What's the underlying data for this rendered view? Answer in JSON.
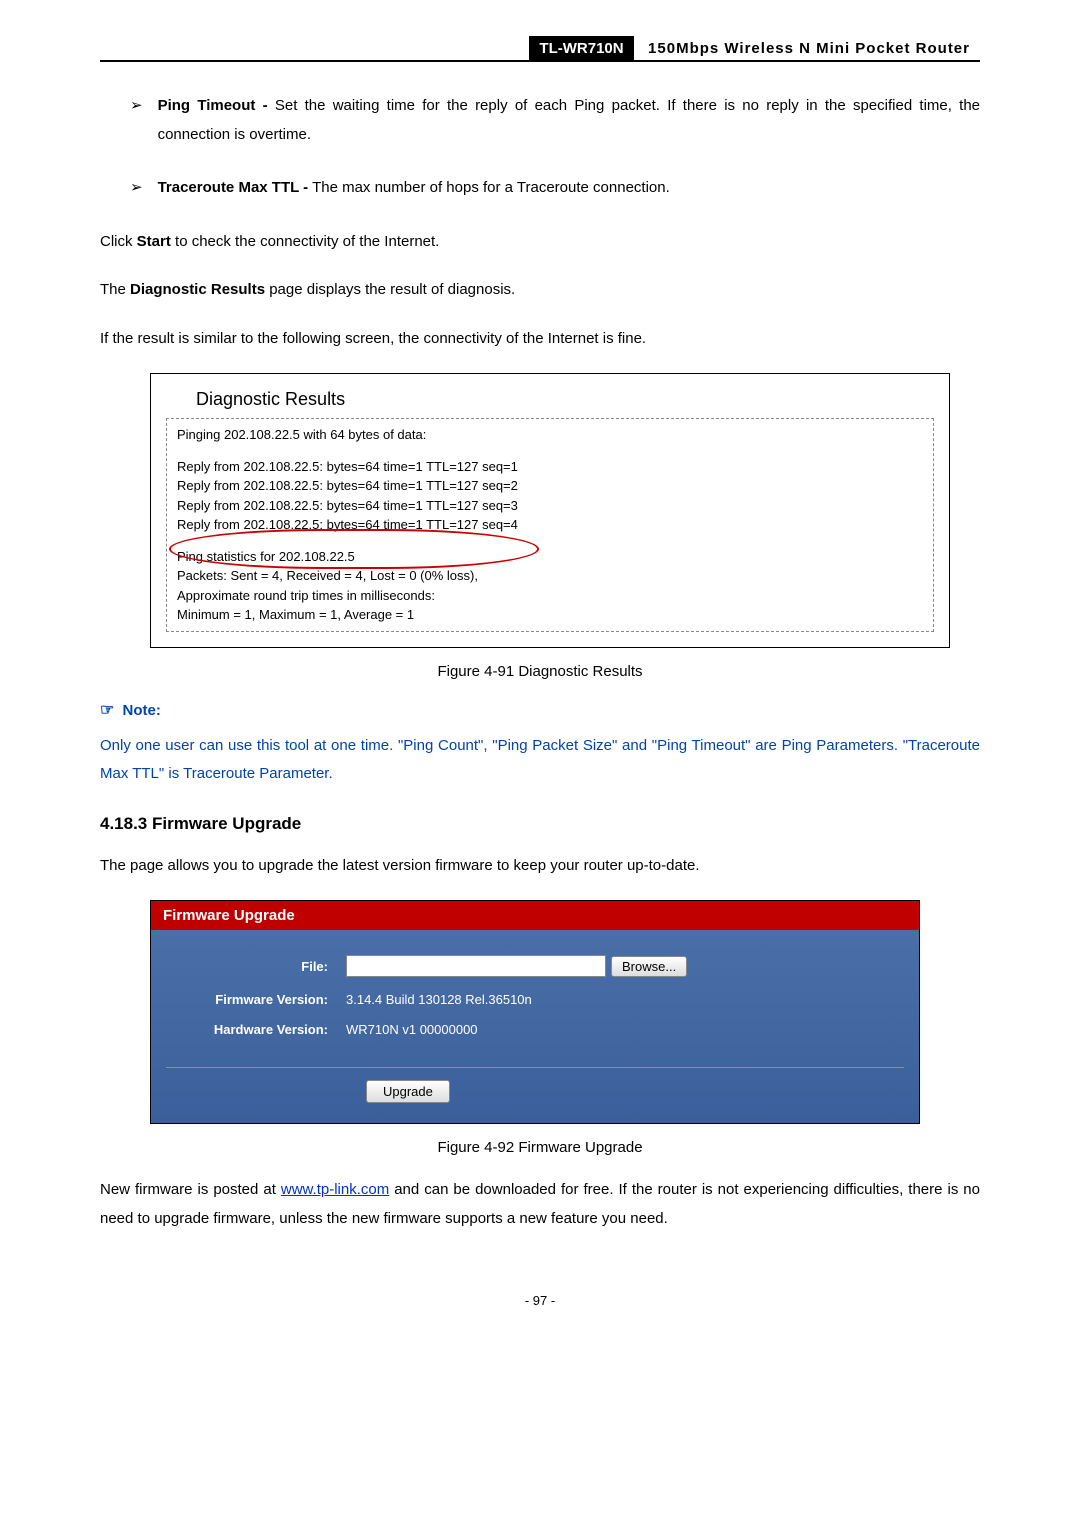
{
  "header": {
    "model": "TL-WR710N",
    "title": "150Mbps Wireless N Mini Pocket Router"
  },
  "bullets": {
    "pingTimeout": {
      "label": "Ping Timeout -",
      "text": " Set the waiting time for the reply of each Ping packet. If there is no reply in the specified time, the connection is overtime."
    },
    "tracerouteTTL": {
      "label": "Traceroute Max TTL -",
      "text": " The max number of hops for a Traceroute connection."
    }
  },
  "paras": {
    "clickStart": "Click ",
    "clickStartBold": "Start",
    "clickStartAfter": " to check the connectivity of the Internet.",
    "diagResults1": "The ",
    "diagResultsBold": "Diagnostic Results",
    "diagResults2": " page displays the result of diagnosis.",
    "ifResult": "If the result is similar to the following screen, the connectivity of the Internet is fine."
  },
  "diagnostic": {
    "title": "Diagnostic Results",
    "lines": {
      "l0": "Pinging 202.108.22.5 with 64 bytes of data:",
      "l1": "Reply from 202.108.22.5:  bytes=64  time=1  TTL=127  seq=1",
      "l2": "Reply from 202.108.22.5:  bytes=64  time=1  TTL=127  seq=2",
      "l3": "Reply from 202.108.22.5:  bytes=64  time=1  TTL=127  seq=3",
      "l4": "Reply from 202.108.22.5:  bytes=64  time=1  TTL=127  seq=4",
      "l5": "Ping statistics for 202.108.22.5",
      "l6": "  Packets: Sent = 4, Received = 4, Lost = 0 (0% loss),",
      "l7": "Approximate round trip times in milliseconds:",
      "l8": "  Minimum = 1, Maximum = 1, Average = 1"
    }
  },
  "fig91": "Figure 4-91    Diagnostic Results",
  "note": {
    "label": "Note:",
    "text": "Only one user can use this tool at one time. \"Ping Count\", \"Ping Packet Size\" and \"Ping Timeout\" are Ping Parameters. \"Traceroute Max TTL\" is Traceroute Parameter."
  },
  "section": {
    "heading": "4.18.3 Firmware Upgrade",
    "intro": "The page allows you to upgrade the latest version firmware to keep your router up-to-date."
  },
  "firmware": {
    "header": "Firmware Upgrade",
    "fileLabel": "File:",
    "fileValue": "",
    "browseLabel": "Browse...",
    "fwVersionLabel": "Firmware Version:",
    "fwVersionValue": "3.14.4 Build 130128 Rel.36510n",
    "hwVersionLabel": "Hardware Version:",
    "hwVersionValue": "WR710N v1 00000000",
    "upgradeLabel": "Upgrade"
  },
  "fig92": "Figure 4-92 Firmware Upgrade",
  "newFirmware": {
    "p1": "New firmware is posted at ",
    "link": "www.tp-link.com",
    "p2": " and can be downloaded for free. If the router is not experiencing difficulties, there is no need to upgrade firmware, unless the new firmware supports a new feature you need."
  },
  "pageNumber": "- 97 -"
}
